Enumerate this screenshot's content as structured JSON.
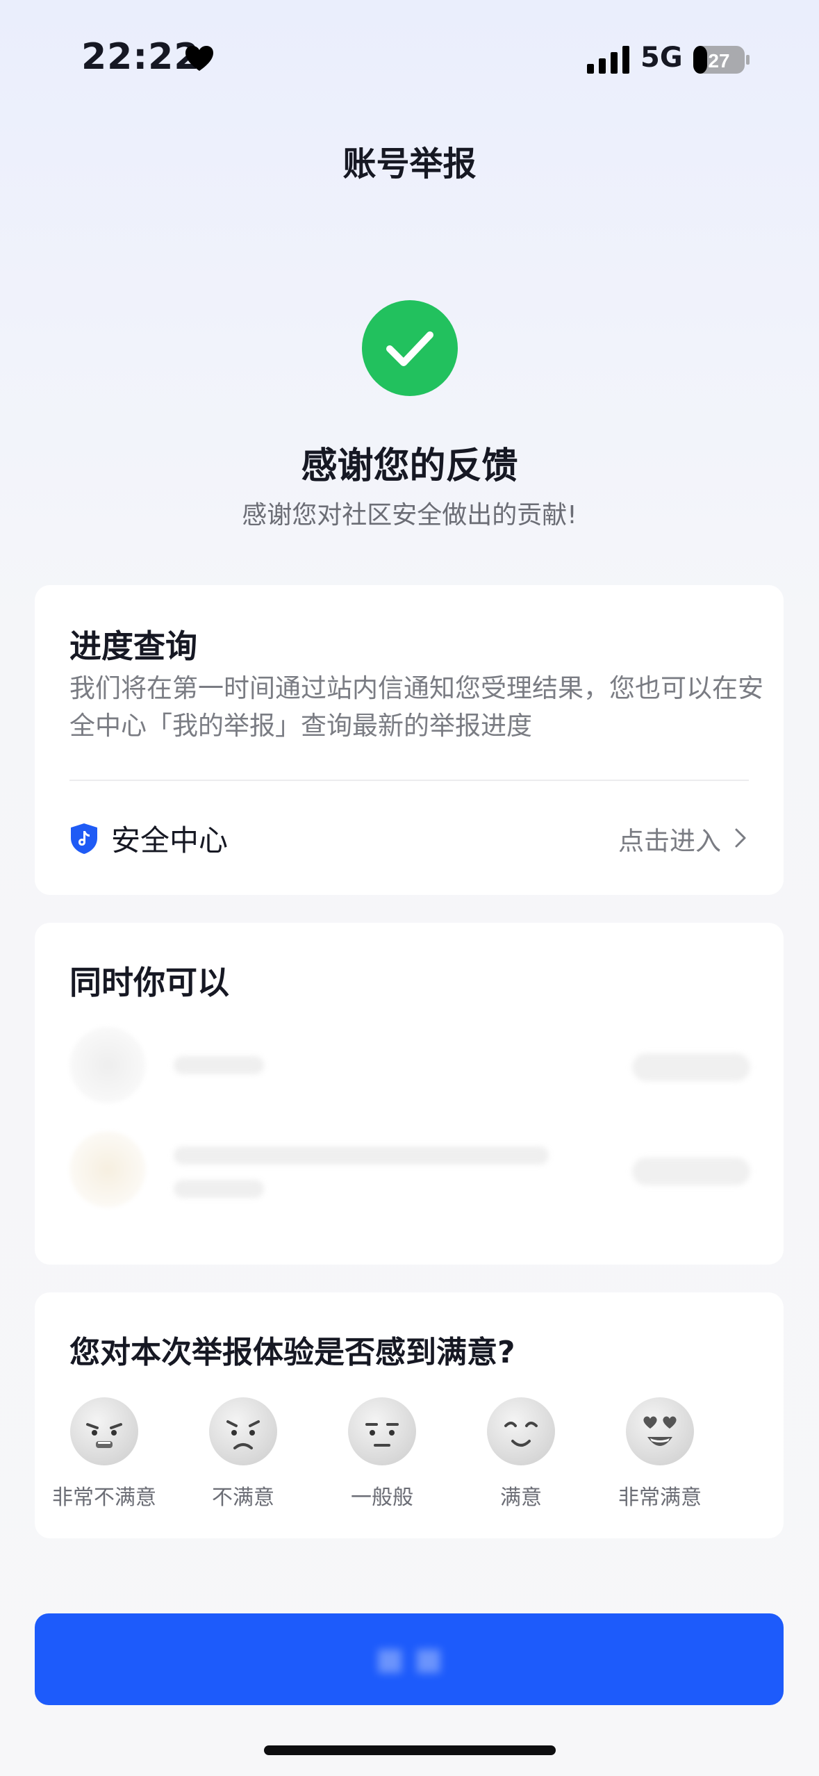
{
  "status_bar": {
    "time": "22:22",
    "network": "5G",
    "battery_level": "27",
    "battery_fraction": 0.27
  },
  "nav": {
    "title": "账号举报"
  },
  "success": {
    "title": "感谢您的反馈",
    "subtitle": "感谢您对社区安全做出的贡献!"
  },
  "progress_card": {
    "title": "进度查询",
    "description": "我们将在第一时间通过站内信通知您受理结果，您也可以在安全中心「我的举报」查询最新的举报进度",
    "security_center_label": "安全中心",
    "enter_label": "点击进入"
  },
  "also_card": {
    "title": "同时你可以"
  },
  "survey": {
    "title": "您对本次举报体验是否感到满意?",
    "options": [
      {
        "label": "非常不满意",
        "icon": "very-dissatisfied-face-icon"
      },
      {
        "label": "不满意",
        "icon": "dissatisfied-face-icon"
      },
      {
        "label": "一般般",
        "icon": "neutral-face-icon"
      },
      {
        "label": "满意",
        "icon": "satisfied-face-icon"
      },
      {
        "label": "非常满意",
        "icon": "very-satisfied-face-icon"
      }
    ]
  },
  "colors": {
    "success_green": "#22c15e",
    "primary_blue": "#1d5bfb",
    "shield_blue": "#1f5bf5"
  }
}
